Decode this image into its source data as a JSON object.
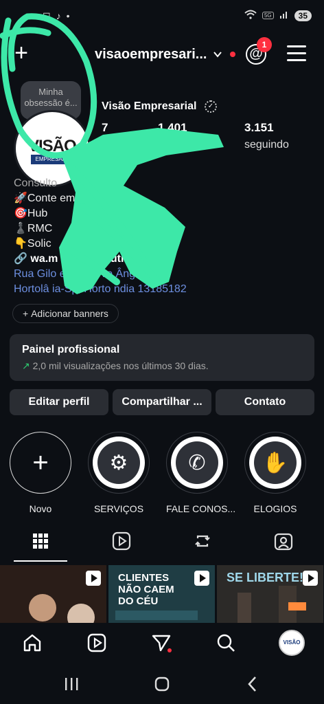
{
  "status": {
    "battery": "35",
    "network": "5G"
  },
  "header": {
    "username": "visaoempresari...",
    "notification_count": "1"
  },
  "note": {
    "text": "Minha obsessão é..."
  },
  "profile": {
    "avatar_text": "VISÃO",
    "avatar_sub": "EMPRESARIAL",
    "display_name": "Visão Empresarial",
    "stats": [
      {
        "value": "7",
        "label": ""
      },
      {
        "value": "1.401",
        "label": ""
      },
      {
        "value": "3.151",
        "label": "seguindo"
      }
    ],
    "category": "Consulto",
    "bio_lines": [
      "🚀Conte           empreende",
      "🎯Hub",
      "♟️RMC",
      "👇Solic"
    ],
    "link": "🔗 wa.m   51995        e outros 3",
    "address_line1": "Rua Gilo    egosso,           vo Ângulo,",
    "address_line2": "Hortolâ   ia-Sp, Horto     ndia 13185182",
    "banner_button": "Adicionar banners"
  },
  "pro_panel": {
    "title": "Painel profissional",
    "subtitle": "2,0 mil visualizações nos últimos 30 dias."
  },
  "actions": [
    {
      "label": "Editar perfil"
    },
    {
      "label": "Compartilhar ..."
    },
    {
      "label": "Contato"
    }
  ],
  "highlights": [
    {
      "label": "Novo",
      "icon": "plus-icon"
    },
    {
      "label": "SERVIÇOS",
      "icon": "gear-wrench-icon"
    },
    {
      "label": "FALE CONOS...",
      "icon": "whatsapp-icon"
    },
    {
      "label": "ELOGIOS",
      "icon": "high-five-icon"
    }
  ],
  "tabs": [
    {
      "icon": "grid-icon"
    },
    {
      "icon": "reels-icon"
    },
    {
      "icon": "repost-icon"
    },
    {
      "icon": "tagged-icon"
    }
  ],
  "posts": [
    {
      "text": "",
      "bg": "#2a1d18"
    },
    {
      "text": "CLIENTES NÃO CAEM DO CÉU",
      "bg": "#1f3d44"
    },
    {
      "text": "SE LIBERTE!",
      "bg": "#2c2a28"
    }
  ],
  "nav": {
    "avatar_text": "VISÃO"
  },
  "colors": {
    "accent": "#ff3040",
    "link": "#6d8fe0",
    "scribble": "#3de8a8"
  }
}
